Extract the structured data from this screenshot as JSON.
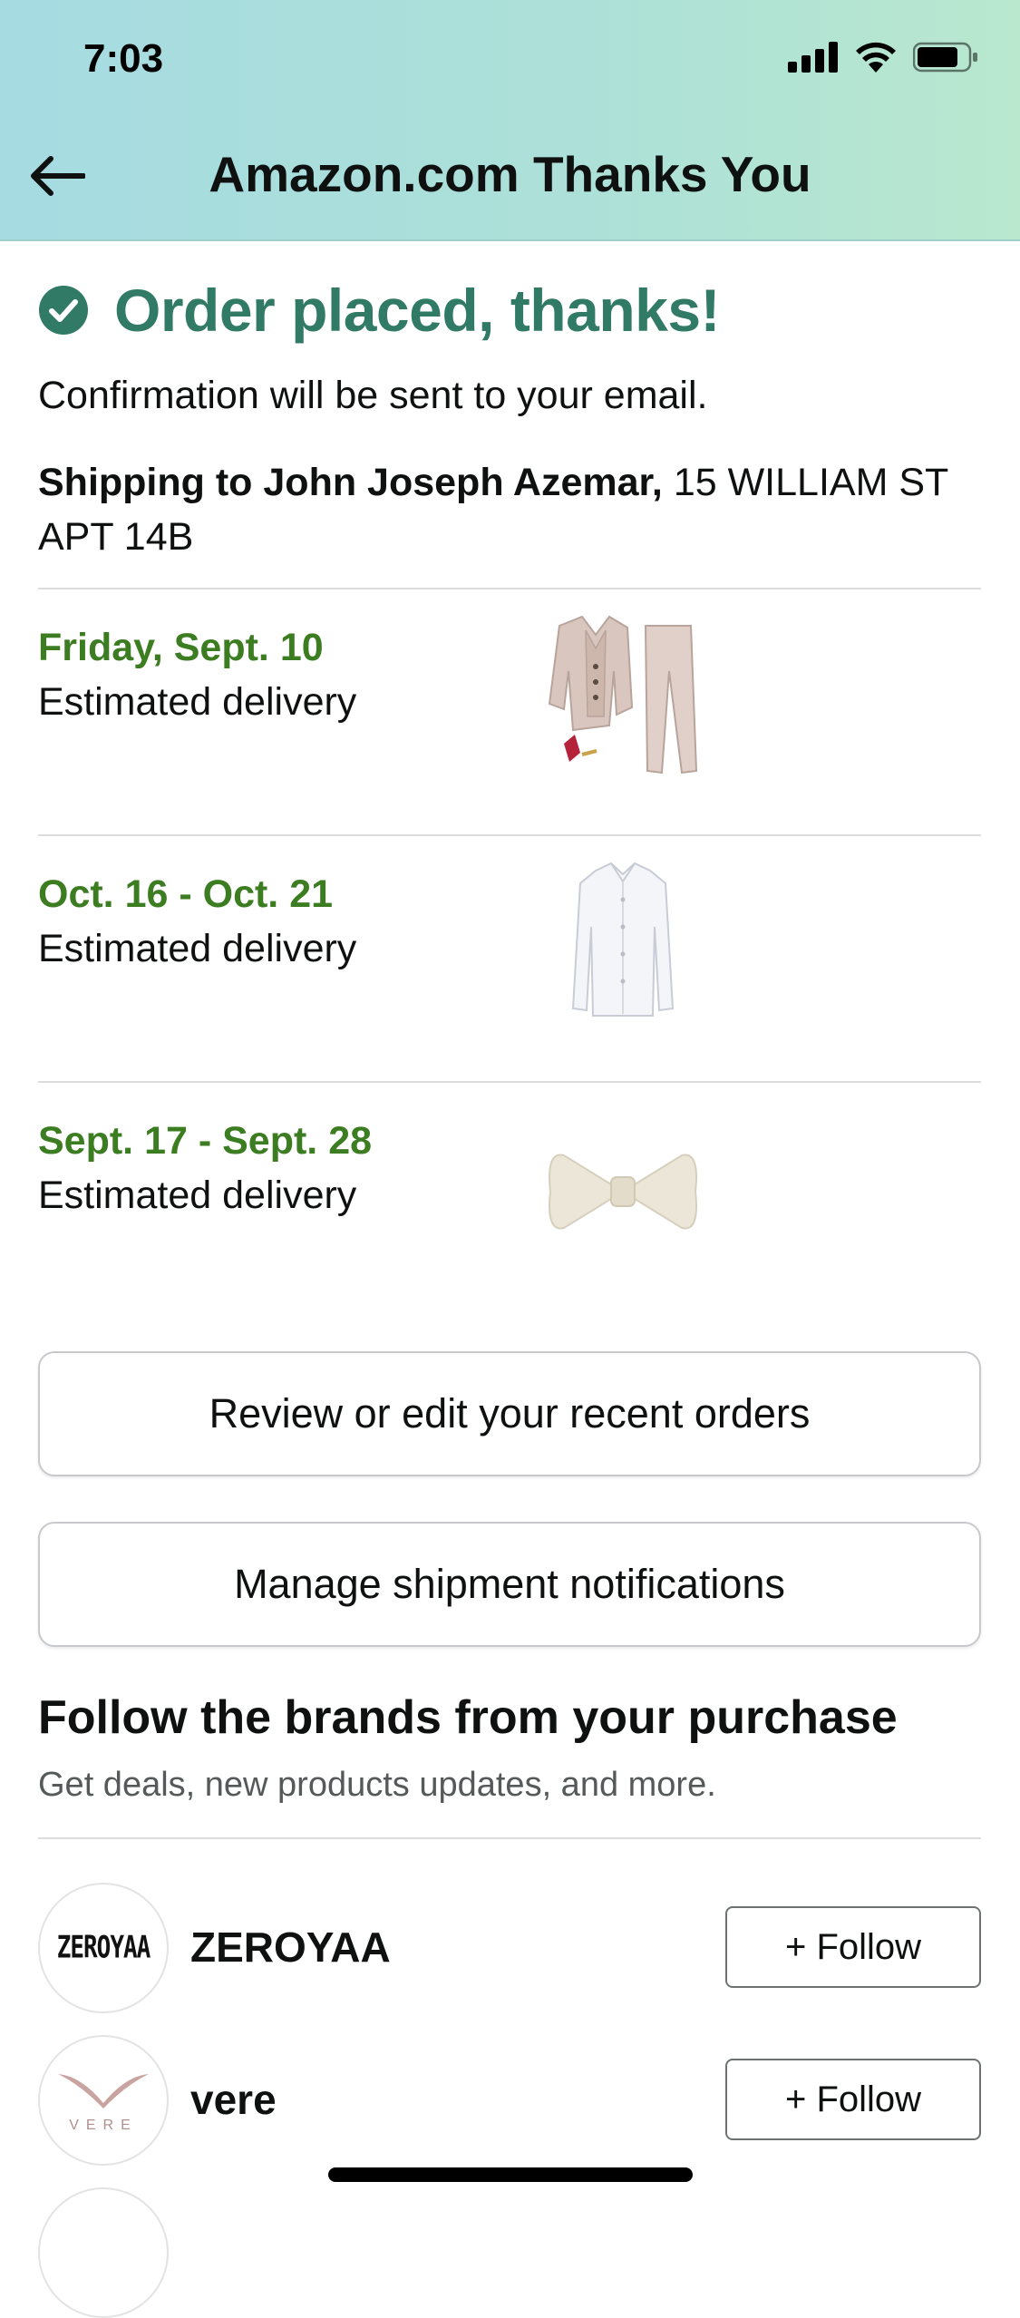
{
  "status_bar": {
    "time": "7:03"
  },
  "header": {
    "title": "Amazon.com Thanks You"
  },
  "confirmation": {
    "title": "Order placed, thanks!",
    "message": "Confirmation will be sent to your email.",
    "shipping_name": "Shipping to John Joseph Azemar,",
    "shipping_address": " 15 WILLIAM ST APT 14B"
  },
  "deliveries": [
    {
      "date": "Friday, Sept. 10",
      "label": "Estimated delivery",
      "item_icon": "suit-icon"
    },
    {
      "date": "Oct. 16 - Oct. 21",
      "label": "Estimated delivery",
      "item_icon": "shirt-icon"
    },
    {
      "date": "Sept. 17 - Sept. 28",
      "label": "Estimated delivery",
      "item_icon": "bowtie-icon"
    }
  ],
  "actions": {
    "review_orders": "Review or edit your recent orders",
    "manage_notifications": "Manage shipment notifications"
  },
  "brands_section": {
    "title": "Follow the brands from your purchase",
    "subtitle": "Get deals, new products updates, and more.",
    "brands": [
      {
        "name": "ZEROYAA",
        "logo_text": "ZEROYAA",
        "follow_label": "+ Follow"
      },
      {
        "name": "vere",
        "logo_text": "VERE",
        "follow_label": "+ Follow"
      }
    ]
  },
  "colors": {
    "success": "#307a66",
    "delivery_date": "#3c7d22",
    "header_gradient_start": "#a6dbe2",
    "header_gradient_end": "#b9e8cf"
  }
}
